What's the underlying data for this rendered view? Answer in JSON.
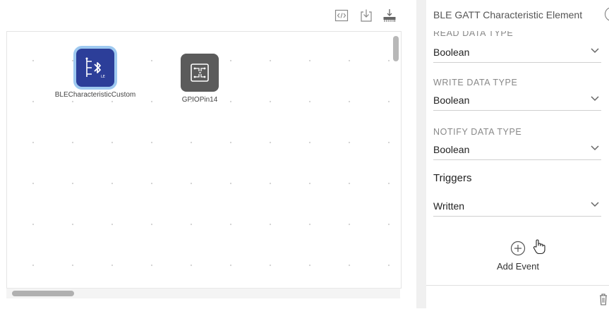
{
  "toolbar": {
    "icons": [
      "code-view-icon",
      "download-icon",
      "deploy-icon"
    ]
  },
  "canvas": {
    "nodes": [
      {
        "label": "BLECharacteristicCustom",
        "icon": "ble-characteristic-icon",
        "selected": true
      },
      {
        "label": "GPIOPin14",
        "icon": "gpio-pin-icon",
        "selected": false
      }
    ]
  },
  "panel": {
    "title": "BLE GATT Characteristic Element",
    "help": "?",
    "fields": [
      {
        "label": "READ DATA TYPE",
        "value": "Boolean"
      },
      {
        "label": "WRITE DATA TYPE",
        "value": "Boolean"
      },
      {
        "label": "NOTIFY DATA TYPE",
        "value": "Boolean"
      }
    ],
    "triggers": {
      "title": "Triggers",
      "value": "Written"
    },
    "add_event": {
      "label": "Add Event"
    }
  },
  "colors": {
    "ble_tile": "#2c3e99",
    "ble_selection": "#9ec9f0",
    "gpio_tile": "#5b5b5b"
  }
}
